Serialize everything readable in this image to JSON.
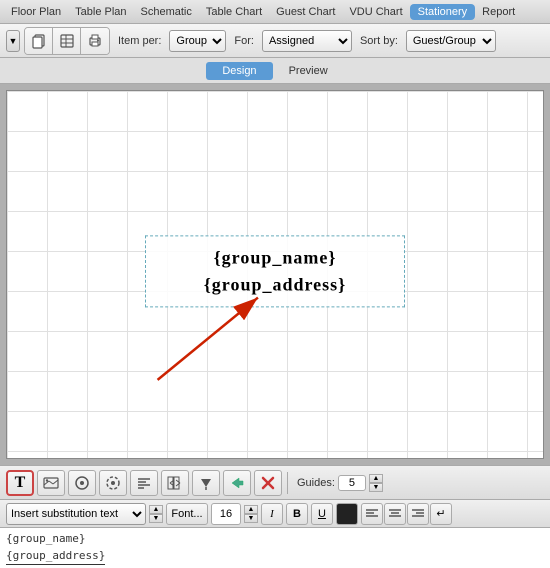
{
  "nav": {
    "items": [
      {
        "label": "Floor Plan",
        "active": false
      },
      {
        "label": "Table Plan",
        "active": false
      },
      {
        "label": "Schematic",
        "active": false
      },
      {
        "label": "Table Chart",
        "active": false
      },
      {
        "label": "Guest Chart",
        "active": false
      },
      {
        "label": "VDU Chart",
        "active": false
      },
      {
        "label": "Stationery",
        "active": true
      },
      {
        "label": "Report",
        "active": false
      }
    ]
  },
  "toolbar": {
    "item_per_label": "Item per:",
    "item_per_value": "Group",
    "for_label": "For:",
    "for_value": "Assigned",
    "sort_by_label": "Sort by:",
    "sort_by_value": "Guest/Group"
  },
  "tabs": {
    "design_label": "Design",
    "preview_label": "Preview",
    "active": "Design"
  },
  "canvas": {
    "text_line1": "{group_name}",
    "text_line2": "{group_address}"
  },
  "bottom_toolbar": {
    "guides_label": "Guides:",
    "guides_value": "5",
    "buttons": [
      "T",
      "≡",
      "◉",
      "⊙",
      "≣",
      "⁋",
      "⇒",
      "↓",
      "✕"
    ]
  },
  "format_bar": {
    "insert_placeholder": "Insert substitution text",
    "font_label": "Font...",
    "font_size": "16",
    "italic_label": "I",
    "bold_label": "B",
    "underline_label": "U",
    "align_options": [
      "left",
      "center",
      "right",
      "justify"
    ],
    "color_hex": "#222222"
  },
  "text_preview": {
    "line1": "{group_name}",
    "line2": "{group_address}"
  }
}
